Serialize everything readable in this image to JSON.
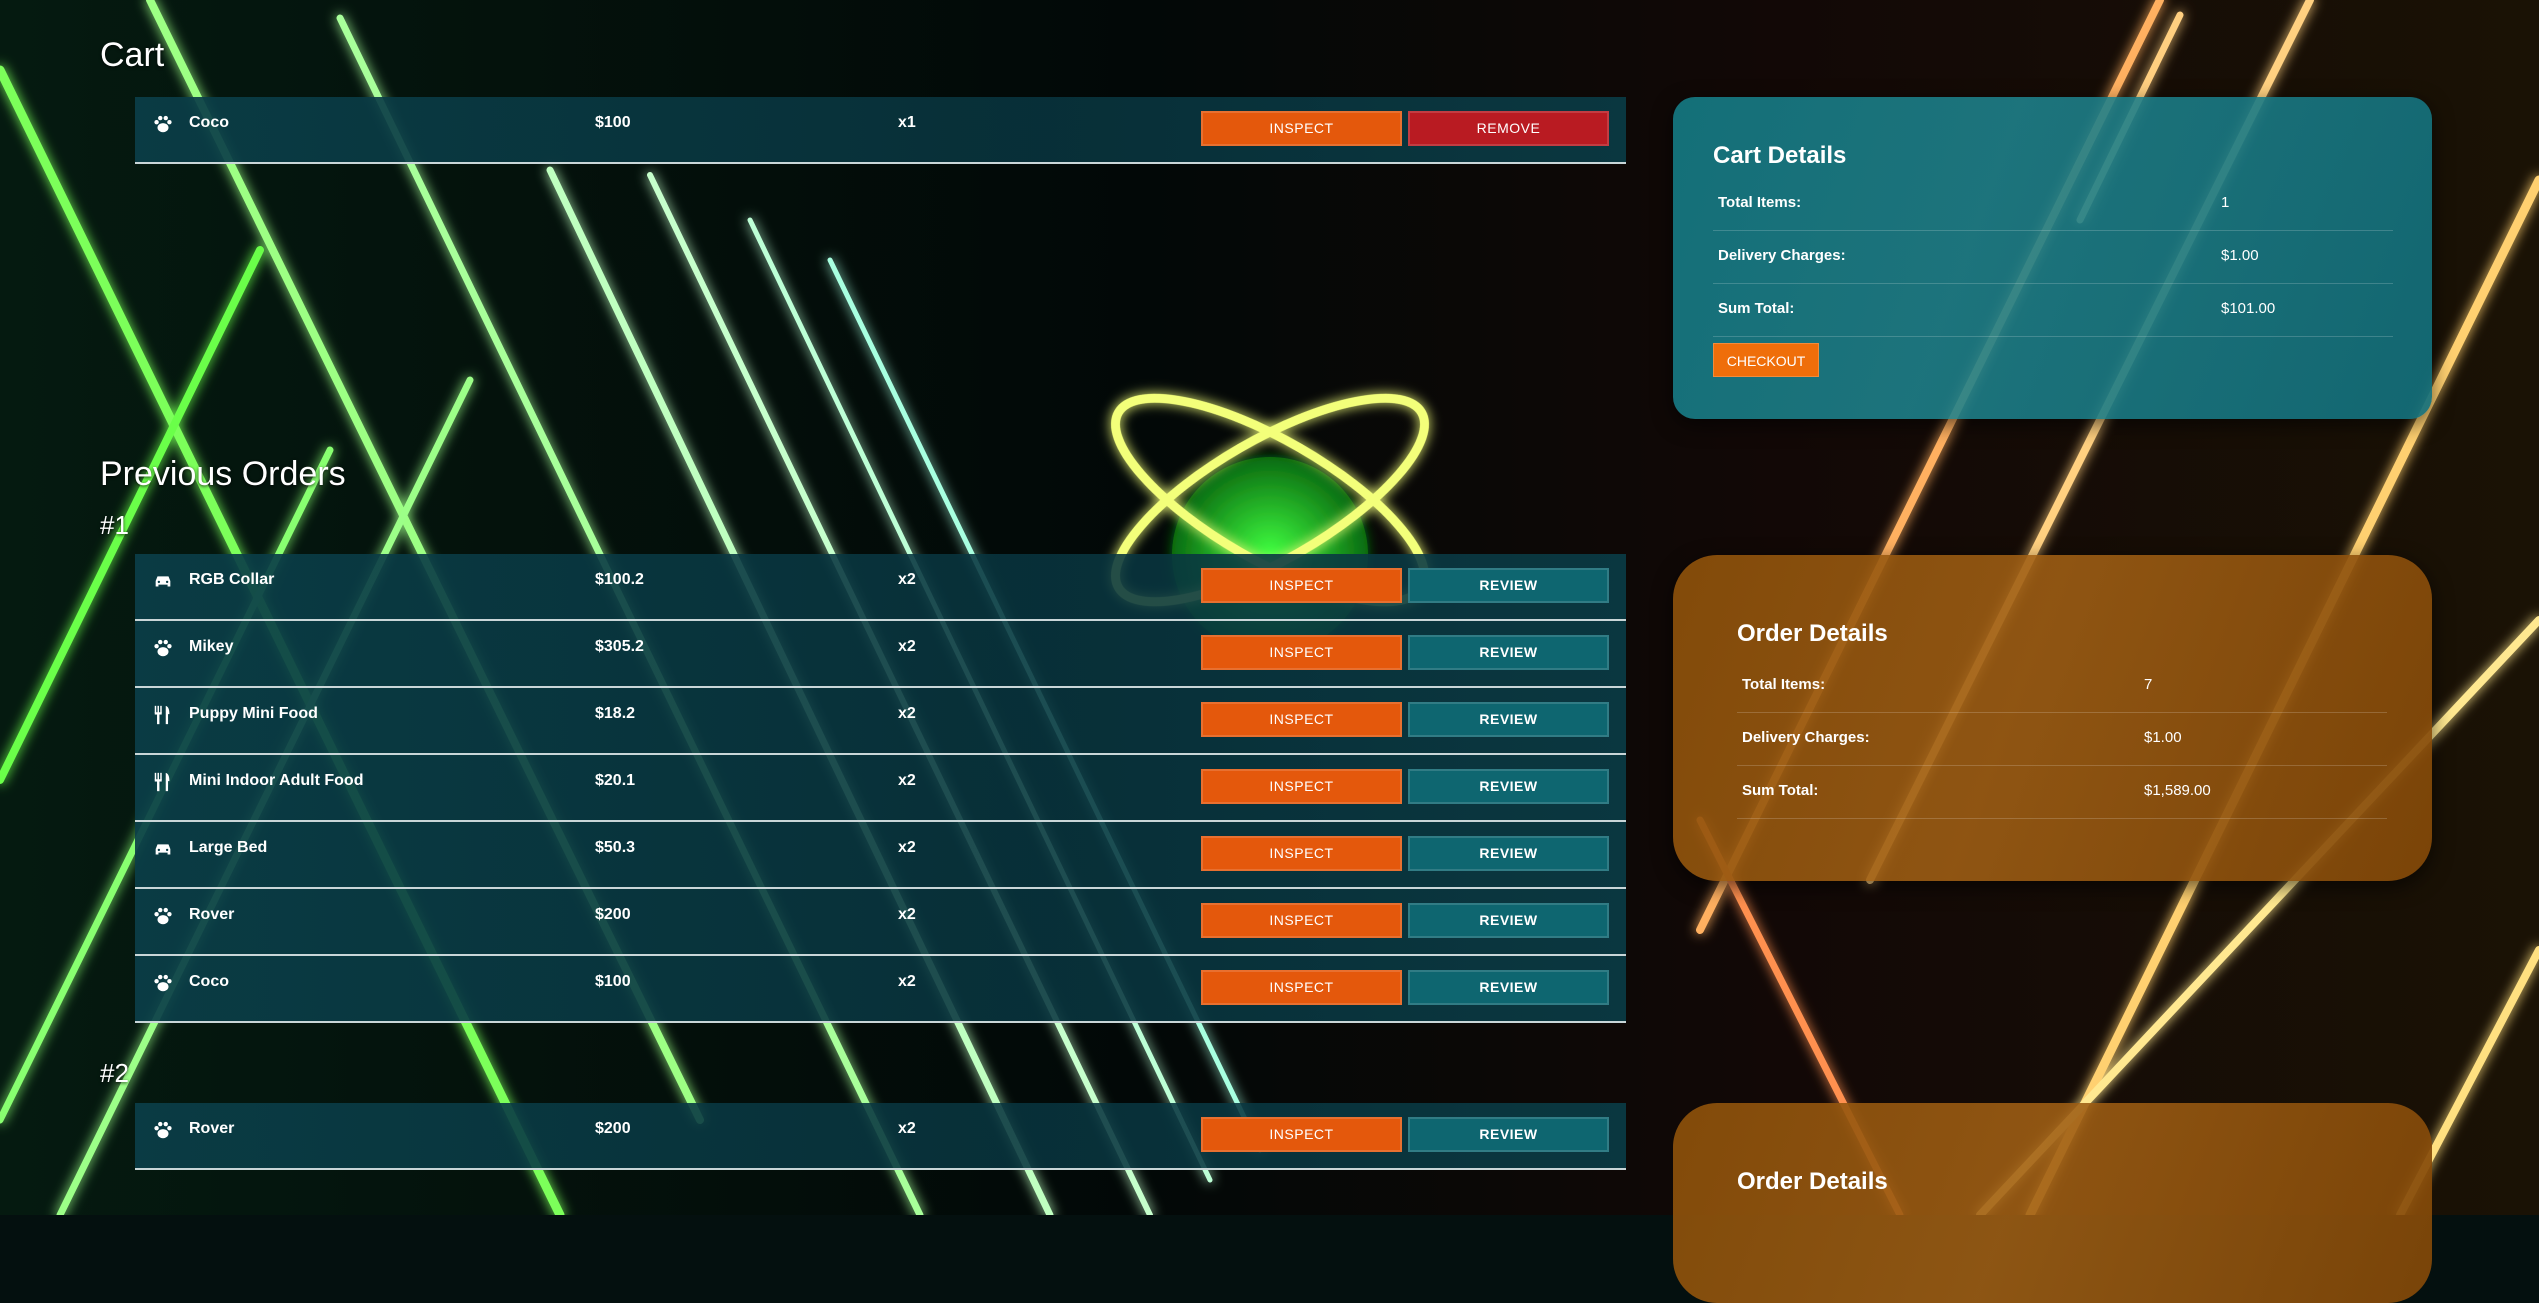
{
  "colors": {
    "inspect": "#e4580c",
    "review": "#0e6670",
    "remove": "#b91b22",
    "checkout": "#ef6e0a",
    "cart_panel": "#167a84",
    "order_panel": "#8c500a"
  },
  "cart": {
    "heading": "Cart",
    "items": [
      {
        "icon": "paw-icon",
        "name": "Coco",
        "price": "$100",
        "qty": "x1",
        "inspect": "INSPECT",
        "remove": "REMOVE"
      }
    ]
  },
  "cart_details": {
    "title": "Cart Details",
    "total_items_label": "Total Items:",
    "total_items": "1",
    "delivery_label": "Delivery Charges:",
    "delivery": "$1.00",
    "sum_label": "Sum Total:",
    "sum": "$101.00",
    "checkout": "CHECKOUT"
  },
  "previous_orders": {
    "heading": "Previous Orders",
    "orders": [
      {
        "number": "#1",
        "items": [
          {
            "icon": "car-icon",
            "name": "RGB Collar",
            "price": "$100.2",
            "qty": "x2",
            "inspect": "INSPECT",
            "review": "REVIEW"
          },
          {
            "icon": "paw-icon",
            "name": "Mikey",
            "price": "$305.2",
            "qty": "x2",
            "inspect": "INSPECT",
            "review": "REVIEW"
          },
          {
            "icon": "utensils-icon",
            "name": "Puppy Mini Food",
            "price": "$18.2",
            "qty": "x2",
            "inspect": "INSPECT",
            "review": "REVIEW"
          },
          {
            "icon": "utensils-icon",
            "name": "Mini Indoor Adult Food",
            "price": "$20.1",
            "qty": "x2",
            "inspect": "INSPECT",
            "review": "REVIEW"
          },
          {
            "icon": "car-icon",
            "name": "Large Bed",
            "price": "$50.3",
            "qty": "x2",
            "inspect": "INSPECT",
            "review": "REVIEW"
          },
          {
            "icon": "paw-icon",
            "name": "Rover",
            "price": "$200",
            "qty": "x2",
            "inspect": "INSPECT",
            "review": "REVIEW"
          },
          {
            "icon": "paw-icon",
            "name": "Coco",
            "price": "$100",
            "qty": "x2",
            "inspect": "INSPECT",
            "review": "REVIEW"
          }
        ],
        "details": {
          "title": "Order Details",
          "total_items_label": "Total Items:",
          "total_items": "7",
          "delivery_label": "Delivery Charges:",
          "delivery": "$1.00",
          "sum_label": "Sum Total:",
          "sum": "$1,589.00"
        }
      },
      {
        "number": "#2",
        "items": [
          {
            "icon": "paw-icon",
            "name": "Rover",
            "price": "$200",
            "qty": "x2",
            "inspect": "INSPECT",
            "review": "REVIEW"
          }
        ],
        "details": {
          "title": "Order Details"
        }
      }
    ]
  }
}
